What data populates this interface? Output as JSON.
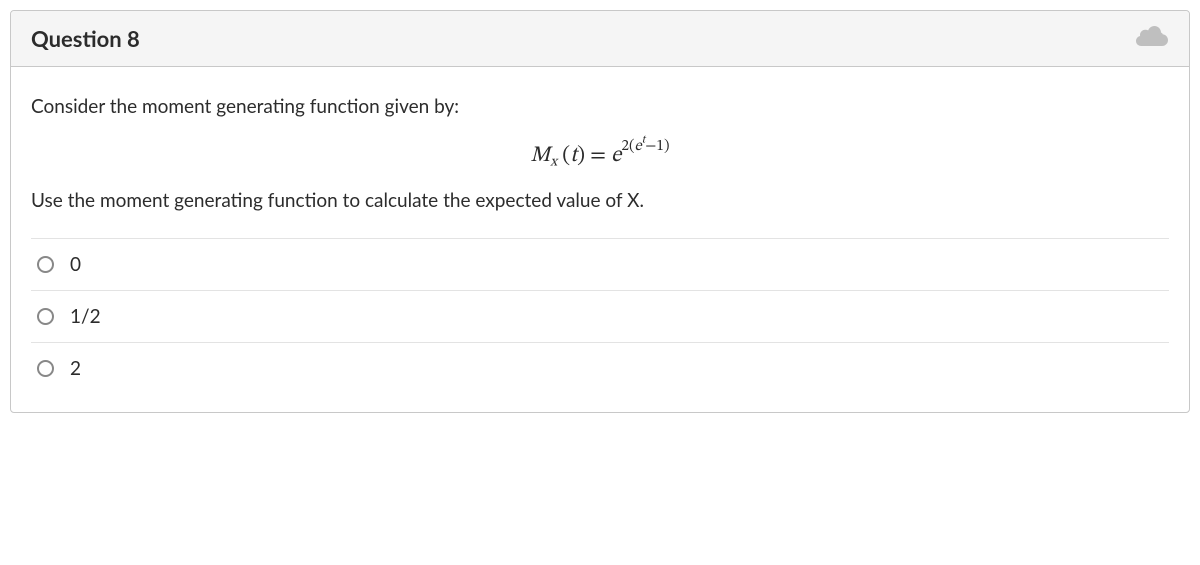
{
  "question": {
    "title": "Question 8",
    "prompt_lead": "Consider the moment generating function given by:",
    "formula": {
      "M": "M",
      "subscript": "x",
      "t_open": " (",
      "t_var": "t",
      "t_close": ") = ",
      "e1": "e",
      "exp_outer_num": "2(",
      "e2": "e",
      "exp_inner": "t",
      "exp_outer_tail": "−1)"
    },
    "prompt_follow": "Use the moment generating function to calculate the expected value of X.",
    "options": [
      {
        "label": "0"
      },
      {
        "label": "1/2"
      },
      {
        "label": "2"
      }
    ]
  }
}
